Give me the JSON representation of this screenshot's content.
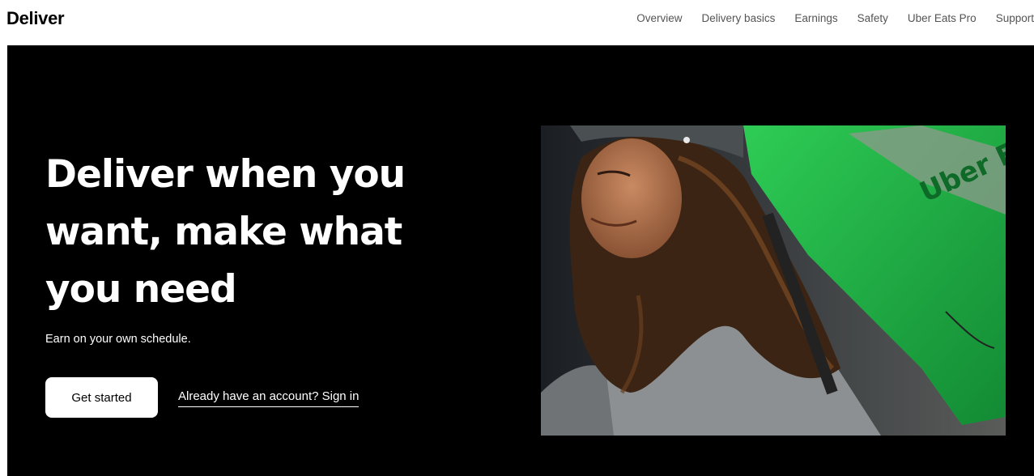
{
  "header": {
    "logo": "Deliver",
    "nav": [
      {
        "label": "Overview"
      },
      {
        "label": "Delivery basics"
      },
      {
        "label": "Earnings"
      },
      {
        "label": "Safety"
      },
      {
        "label": "Uber Eats Pro"
      },
      {
        "label": "Support"
      }
    ]
  },
  "hero": {
    "headline": "Deliver when you want, make what you need",
    "subtitle": "Earn on your own schedule.",
    "primary_button": "Get started",
    "signin_link": "Already have an account? Sign in",
    "image_bag_text": "Uber Eats"
  },
  "colors": {
    "hero_background": "#000000",
    "bag_green": "#1fa341",
    "nav_text": "#545454"
  }
}
